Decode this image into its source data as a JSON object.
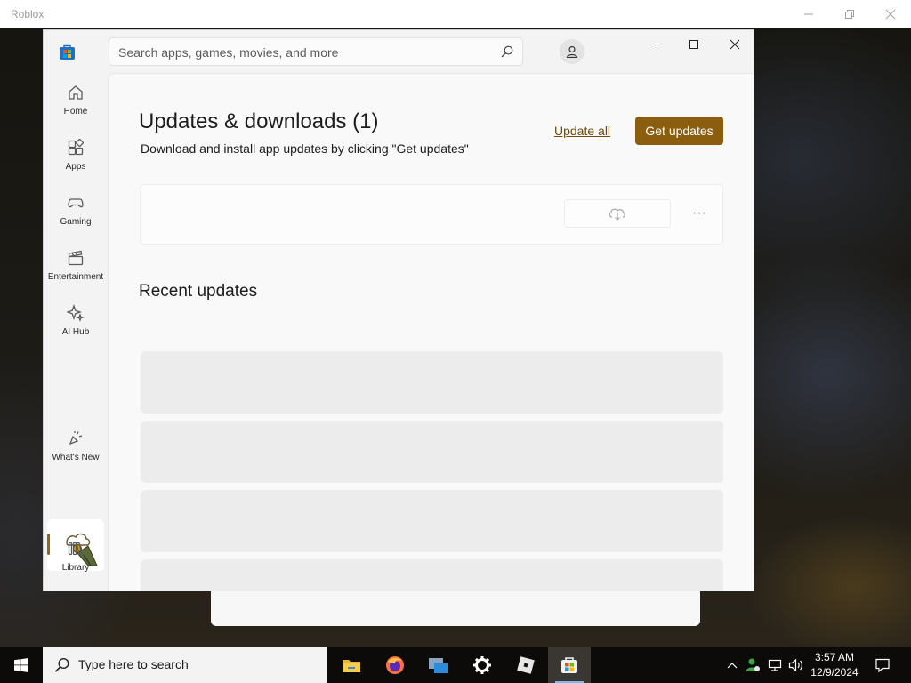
{
  "outer_window": {
    "title": "Roblox"
  },
  "store": {
    "search_placeholder": "Search apps, games, movies, and more",
    "sidebar": [
      {
        "label": "Home",
        "icon": "home-icon"
      },
      {
        "label": "Apps",
        "icon": "apps-icon"
      },
      {
        "label": "Gaming",
        "icon": "gaming-icon"
      },
      {
        "label": "Entertainment",
        "icon": "entertainment-icon"
      },
      {
        "label": "AI Hub",
        "icon": "ai-hub-icon"
      },
      {
        "label": "What's New",
        "icon": "whats-new-icon"
      },
      {
        "label": "",
        "icon": "downloads-icon",
        "active": true
      },
      {
        "label": "Library",
        "icon": "library-icon"
      }
    ],
    "main": {
      "title": "Updates & downloads (1)",
      "subtitle": "Download and install app updates by clicking \"Get updates\"",
      "update_all_label": "Update all",
      "get_updates_label": "Get updates",
      "more_label": "···",
      "recent_title": "Recent updates"
    },
    "accent_color": "#8b5e0f"
  },
  "taskbar": {
    "search_placeholder": "Type here to search",
    "apps": [
      "file-explorer-icon",
      "firefox-icon",
      "desktop-window-icon",
      "settings-icon",
      "roblox-icon",
      "microsoft-store-icon"
    ],
    "time": "3:57 AM",
    "date": "12/9/2024"
  }
}
